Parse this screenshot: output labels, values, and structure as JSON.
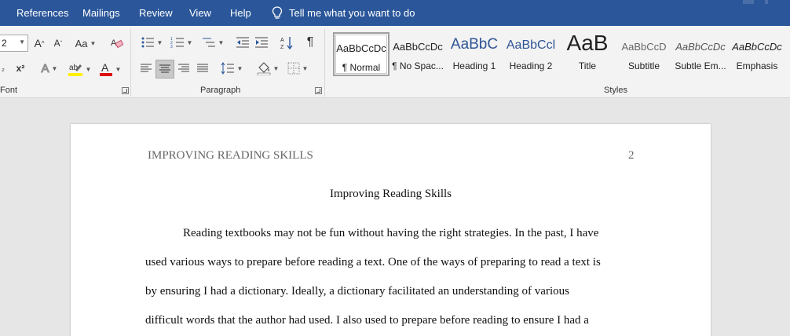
{
  "tabs": [
    "References",
    "Mailings",
    "Review",
    "View",
    "Help"
  ],
  "tell_me": "Tell me what you want to do",
  "ribbon": {
    "font_size": "2",
    "font_group_label": "Font",
    "paragraph_group_label": "Paragraph",
    "styles_group_label": "Styles",
    "change_case_label": "Aa",
    "colors": {
      "highlight": "#ffef00",
      "font_color": "#e01010",
      "accent": "#2b579a"
    }
  },
  "styles": [
    {
      "sample": "AaBbCcDc",
      "name": "¶ Normal"
    },
    {
      "sample": "AaBbCcDc",
      "name": "¶ No Spac..."
    },
    {
      "sample": "AaBbC",
      "name": "Heading 1"
    },
    {
      "sample": "AaBbCcl",
      "name": "Heading 2"
    },
    {
      "sample": "AaB",
      "name": "Title"
    },
    {
      "sample": "AaBbCcD",
      "name": "Subtitle"
    },
    {
      "sample": "AaBbCcDc",
      "name": "Subtle Em..."
    },
    {
      "sample": "AaBbCcDc",
      "name": "Emphasis"
    }
  ],
  "document": {
    "header": "IMPROVING READING SKILLS",
    "page_number": "2",
    "title": "Improving Reading Skills",
    "lines": [
      "Reading textbooks may not be fun without having the right strategies. In the past, I have",
      "used various ways to prepare before reading a text. One of the ways of preparing to read a text is",
      "by ensuring I had a dictionary. Ideally, a dictionary facilitated an understanding of various",
      "difficult words that the author had used. I also used to prepare before reading to ensure I had a"
    ]
  }
}
